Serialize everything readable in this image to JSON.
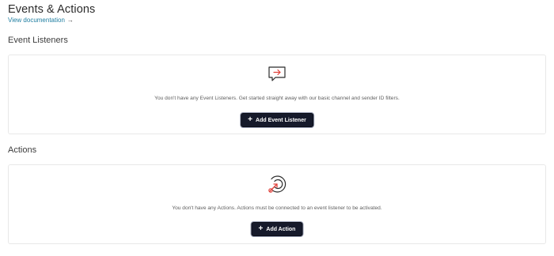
{
  "header": {
    "title": "Events & Actions",
    "doc_link": "View documentation",
    "doc_link_arrow": "→"
  },
  "event_listeners": {
    "title": "Event Listeners",
    "icon": "chat-arrow-icon",
    "empty_text": "You don't have any Event Listeners. Get started straight away with our basic channel and sender ID filters.",
    "button_label": "Add Event Listener",
    "button_icon": "+"
  },
  "actions": {
    "title": "Actions",
    "icon": "target-arrow-icon",
    "empty_text": "You don't have any Actions. Actions must be connected to an event listener to be activated.",
    "button_label": "Add Action",
    "button_icon": "+"
  },
  "colors": {
    "accent_red": "#e0403a",
    "button_bg": "#161a2b",
    "link": "#1f7ea1"
  }
}
